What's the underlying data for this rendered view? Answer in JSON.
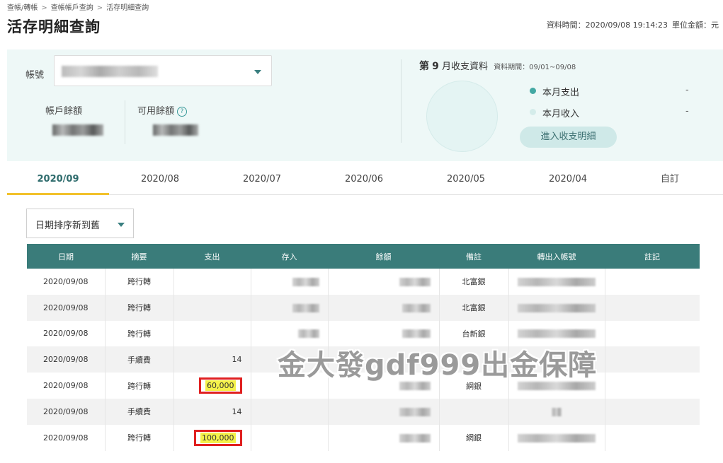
{
  "breadcrumb": [
    "查帳/轉帳",
    "查帳帳戶查詢",
    "活存明細查詢"
  ],
  "page_title": "活存明細查詢",
  "meta": {
    "data_time": "資料時間：2020/09/08 19:14:23",
    "unit": "單位金額：元"
  },
  "account": {
    "label": "帳號"
  },
  "balance": {
    "account_balance_label": "帳戶餘額",
    "available_balance_label": "可用餘額"
  },
  "month_summary": {
    "title_prefix": "第",
    "month": "9",
    "title_suffix": "月收支資料",
    "range": "資料期間：09/01~09/08",
    "expense_label": "本月支出",
    "expense_value": "-",
    "income_label": "本月收入",
    "income_value": "-",
    "detail_button": "進入收支明細"
  },
  "tabs": [
    "2020/09",
    "2020/08",
    "2020/07",
    "2020/06",
    "2020/05",
    "2020/04",
    "自訂"
  ],
  "active_tab": 0,
  "sort_label": "日期排序新到舊",
  "table": {
    "headers": [
      "日期",
      "摘要",
      "支出",
      "存入",
      "餘額",
      "備註",
      "轉出入帳號",
      "註記"
    ],
    "rows": [
      {
        "date": "2020/09/08",
        "summary": "跨行轉",
        "expense": "",
        "note": "北富銀"
      },
      {
        "date": "2020/09/08",
        "summary": "跨行轉",
        "expense": "",
        "note": "北富銀"
      },
      {
        "date": "2020/09/08",
        "summary": "跨行轉",
        "expense": "",
        "note": "台新銀"
      },
      {
        "date": "2020/09/08",
        "summary": "手續費",
        "expense": "14",
        "note": ""
      },
      {
        "date": "2020/09/08",
        "summary": "跨行轉",
        "expense": "60,000",
        "note": "網銀"
      },
      {
        "date": "2020/09/08",
        "summary": "手續費",
        "expense": "14",
        "note": ""
      },
      {
        "date": "2020/09/08",
        "summary": "跨行轉",
        "expense": "100,000",
        "note": "網銀"
      }
    ]
  },
  "watermark": "金大發gdf999出金保障",
  "colors": {
    "accent": "#3a7c7a",
    "tab_underline": "#f2c22d",
    "highlight": "#f4f14a",
    "highlight_border": "#e02020"
  }
}
